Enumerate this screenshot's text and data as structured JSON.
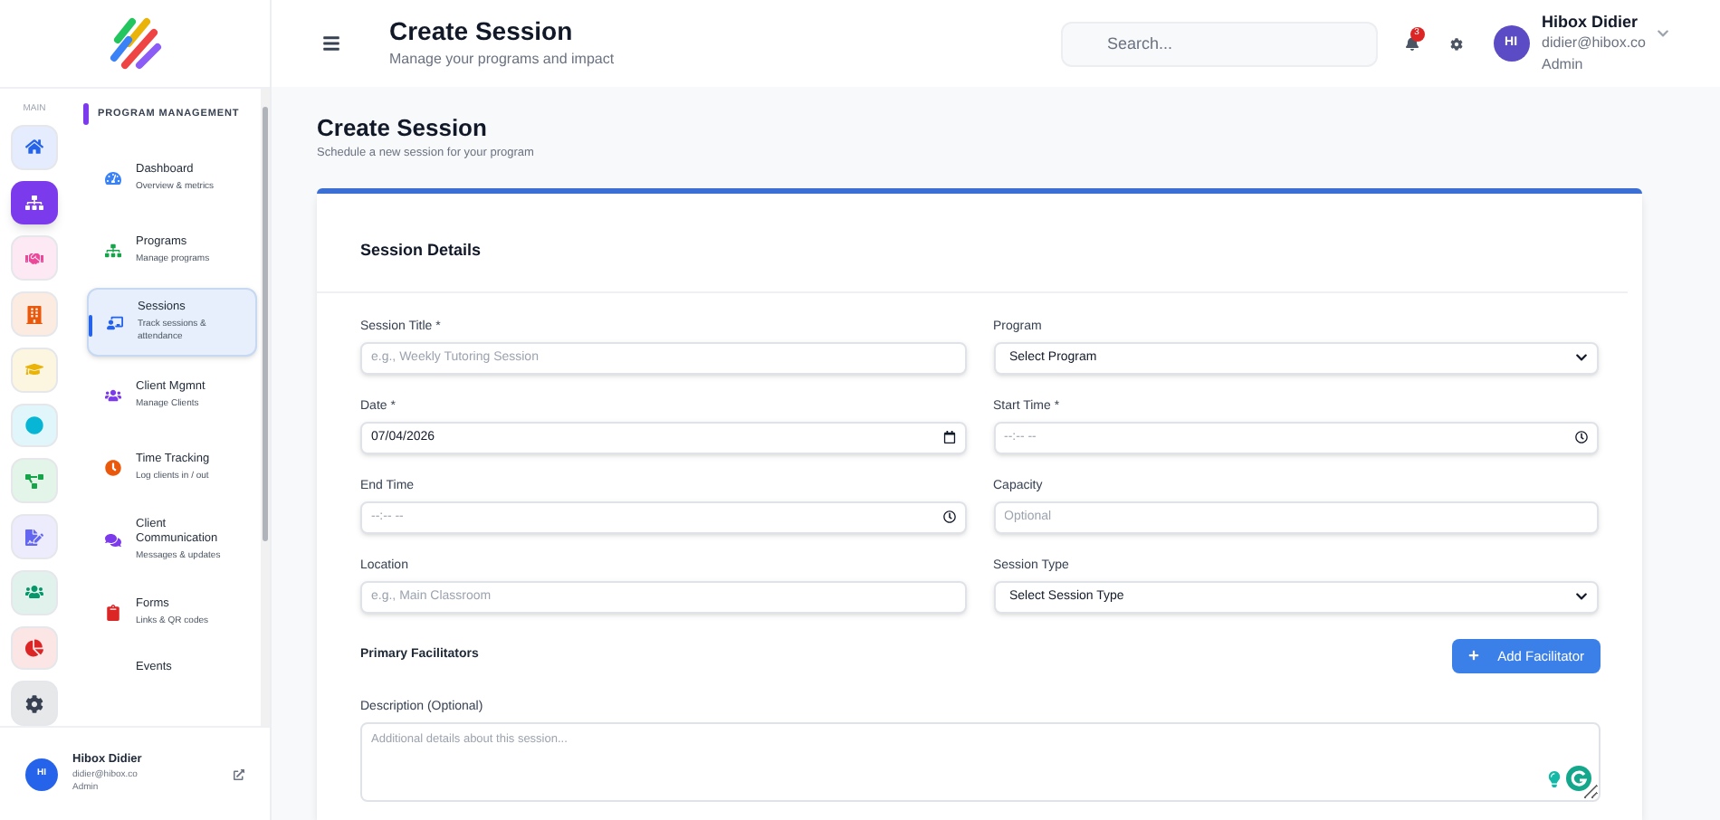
{
  "sidebar": {
    "rail_label": "MAIN",
    "rail": [
      {
        "color": "#2563eb",
        "selected": false
      },
      {
        "color": "#7c3aed",
        "selected": true
      },
      {
        "color": "#ec4899",
        "selected": false
      },
      {
        "color": "#ea580c",
        "selected": false
      },
      {
        "color": "#eab308",
        "selected": false
      },
      {
        "color": "#06b6d4",
        "selected": false
      },
      {
        "color": "#16a34a",
        "selected": false
      },
      {
        "color": "#6366f1",
        "selected": false
      },
      {
        "color": "#059669",
        "selected": false
      },
      {
        "color": "#dc2626",
        "selected": false
      },
      {
        "color": "#374151",
        "selected": false
      }
    ],
    "section": "PROGRAM MANAGEMENT",
    "items": [
      {
        "title": "Dashboard",
        "subtitle": "Overview & metrics",
        "color": "#3b82f6",
        "selected": false
      },
      {
        "title": "Programs",
        "subtitle": "Manage programs",
        "color": "#16a34a",
        "selected": false
      },
      {
        "title": "Sessions",
        "subtitle": "Track sessions & attendance",
        "color": "#2563eb",
        "selected": true
      },
      {
        "title": "Client Mgmnt",
        "subtitle": "Manage Clients",
        "color": "#7c3aed",
        "selected": false
      },
      {
        "title": "Time Tracking",
        "subtitle": "Log clients in / out",
        "color": "#ea580c",
        "selected": false
      },
      {
        "title": "Client Communication",
        "subtitle": "Messages & updates",
        "color": "#7c3aed",
        "selected": false
      },
      {
        "title": "Forms",
        "subtitle": "Links & QR codes",
        "color": "#dc2626",
        "selected": false
      },
      {
        "title": "Events",
        "selected": false
      }
    ],
    "user": {
      "initials": "HI",
      "name": "Hibox Didier",
      "email": "didier@hibox.co",
      "role": "Admin"
    }
  },
  "header": {
    "title": "Create Session",
    "subtitle": "Manage your programs and impact",
    "search": {
      "placeholder": "Search..."
    },
    "notifications": "3",
    "user": {
      "initials": "HI",
      "name": "Hibox Didier",
      "email": "didier@hibox.co",
      "role": "Admin"
    }
  },
  "page": {
    "title": "Create Session",
    "subtitle": "Schedule a new session for your program"
  },
  "card": {
    "title": "Session Details",
    "fields": [
      {
        "kind": "text",
        "label": "Session Title *",
        "placeholder": "e.g., Weekly Tutoring Session"
      },
      {
        "kind": "select",
        "label": "Program",
        "value": "Select Program"
      },
      {
        "kind": "date",
        "label": "Date *",
        "value": "07/04/2026"
      },
      {
        "kind": "time",
        "label": "Start Time *",
        "placeholder": "--:-- --"
      },
      {
        "kind": "time",
        "label": "End Time",
        "placeholder": "--:-- --"
      },
      {
        "kind": "text",
        "label": "Capacity",
        "placeholder": "Optional"
      },
      {
        "kind": "text",
        "label": "Location",
        "placeholder": "e.g., Main Classroom"
      },
      {
        "kind": "select",
        "label": "Session Type",
        "value": "Select Session Type"
      }
    ],
    "facilitators": {
      "label": "Primary Facilitators",
      "button": "Add Facilitator"
    },
    "description": {
      "label": "Description (Optional)",
      "placeholder": "Additional details about this session..."
    }
  }
}
